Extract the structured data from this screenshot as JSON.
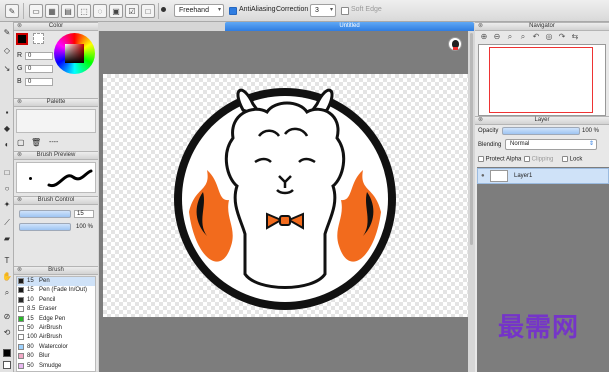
{
  "toolbar": {
    "stroke_mode": "Freehand",
    "antialiasing_label": "AntiAliasing",
    "antialiasing_on": true,
    "correction_label": "Correction",
    "correction_value": "3",
    "soft_edge_label": "Soft Edge",
    "soft_edge_on": false
  },
  "document": {
    "tab_title": "Untitled"
  },
  "color_panel": {
    "title": "Color",
    "r_label": "R",
    "r_value": "0",
    "g_label": "G",
    "g_value": "0",
    "b_label": "B",
    "b_value": "0",
    "foreground_color": "#000000"
  },
  "palette_panel": {
    "title": "Palette",
    "more_label": "----"
  },
  "brush_preview": {
    "title": "Brush Preview"
  },
  "brush_control": {
    "title": "Brush Control",
    "size_value": "15",
    "opacity_value": "100 %"
  },
  "brush_panel": {
    "title": "Brush",
    "items": [
      {
        "size": "15",
        "name": "Pen",
        "color": "#1a1a1a",
        "selected": true
      },
      {
        "size": "15",
        "name": "Pen (Fade In/Out)",
        "color": "#1a1a1a",
        "selected": false
      },
      {
        "size": "10",
        "name": "Pencil",
        "color": "#2a2a2a",
        "selected": false
      },
      {
        "size": "8.5",
        "name": "Eraser",
        "color": "#ffffff",
        "selected": false
      },
      {
        "size": "15",
        "name": "Edge Pen",
        "color": "#28b828",
        "selected": false
      },
      {
        "size": "50",
        "name": "AirBrush",
        "color": "#ffffff",
        "selected": false
      },
      {
        "size": "100",
        "name": "AirBrush",
        "color": "#ffffff",
        "selected": false
      },
      {
        "size": "80",
        "name": "Watercolor",
        "color": "#9fd3ff",
        "selected": false
      },
      {
        "size": "80",
        "name": "Blur",
        "color": "#f2a9c7",
        "selected": false
      },
      {
        "size": "50",
        "name": "Smudge",
        "color": "#e8b8f0",
        "selected": false
      }
    ]
  },
  "navigator": {
    "title": "Navigator"
  },
  "layer_panel": {
    "title": "Layer",
    "opacity_label": "Opacity",
    "opacity_value": "100 %",
    "blending_label": "Blending",
    "blending_value": "Normal",
    "protect_alpha_label": "Protect Alpha",
    "clipping_label": "Clipping",
    "lock_label": "Lock",
    "layers": [
      {
        "name": "Layer1"
      }
    ]
  },
  "artwork": {
    "fire_color": "#f26b1d",
    "ring_color": "#111111",
    "body_color": "#ffffff",
    "bowtie_color": "#f26b1d"
  },
  "watermark": {
    "text": "最需网"
  }
}
